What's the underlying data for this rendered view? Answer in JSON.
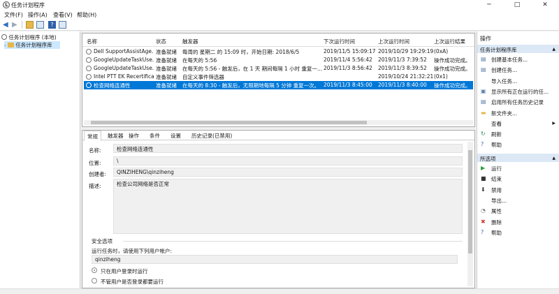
{
  "window": {
    "title": "任务计划程序",
    "min": "─",
    "max": "□",
    "close": "✕"
  },
  "menu": [
    "文件(F)",
    "操作(A)",
    "查看(V)",
    "帮助(H)"
  ],
  "tree": {
    "root": "任务计划程序 (本地)",
    "child": "任务计划程序库"
  },
  "columns": [
    "名称",
    "状态",
    "触发器",
    "下次运行时间",
    "上次运行时间",
    "上次运行结果"
  ],
  "tasks": [
    [
      "Dell SupportAssistAge...",
      "准备就绪",
      "每周的 星期二 的 15:09 时，开始日期: 2018/6/5",
      "2019/11/5 15:09:17",
      "2019/10/29 19:29:19",
      "(0xA)"
    ],
    [
      "GoogleUpdateTaskUse...",
      "准备就绪",
      "在每天的 5:56",
      "2019/11/4 5:56:42",
      "2019/11/3 7:39:52",
      "操作成功完成。"
    ],
    [
      "GoogleUpdateTaskUse...",
      "准备就绪",
      "在每天的 5:56 - 触发后，在 1 天 期间每隔 1 小时 重复一...",
      "2019/11/3 8:56:42",
      "2019/11/3 8:39:52",
      "操作成功完成。"
    ],
    [
      "Intel PTT EK Recertifica...",
      "准备就绪",
      "自定义事件筛选器",
      "",
      "2019/10/24 21:32:21",
      "(0x1)"
    ],
    [
      "检查网络连通性",
      "准备就绪",
      "在每天的 8:30 - 触发后，无限期地每隔 5 分钟 重复一次。",
      "2019/11/3 8:45:00",
      "2019/11/3 8:40:00",
      "操作成功完成。"
    ]
  ],
  "detail_tabs": [
    "常规",
    "触发器",
    "操作",
    "条件",
    "设置",
    "历史记录(已禁用)"
  ],
  "detail": {
    "name_label": "名称:",
    "name": "检查网络连通性",
    "location_label": "位置:",
    "location": "\\",
    "author_label": "创建者:",
    "author": "QINZIHENG\\qinziheng",
    "desc_label": "描述:",
    "desc": "检查公司网络是否正常",
    "security_title": "安全选项",
    "run_as_label": "运行任务时，请使用下列用户帐户:",
    "run_as_user": "qinziheng",
    "radio1": "只在用户登录时运行",
    "radio2": "不管用户是否登录都要运行"
  },
  "actions": {
    "title": "操作",
    "section1": "任务计划程序库",
    "items1": [
      {
        "icon": "create-basic-task-icon",
        "glyph": "▤",
        "color": "#5a7ea8",
        "label": "创建基本任务..."
      },
      {
        "icon": "create-task-icon",
        "glyph": "▤",
        "color": "#5a7ea8",
        "label": "创建任务..."
      },
      {
        "icon": "blank-icon",
        "glyph": "",
        "color": "#000",
        "label": "导入任务..."
      },
      {
        "icon": "running-tasks-icon",
        "glyph": "▣",
        "color": "#5a7ea8",
        "label": "显示所有正在运行的任..."
      },
      {
        "icon": "history-icon",
        "glyph": "▤",
        "color": "#5a7ea8",
        "label": "启用所有任务历史记录"
      },
      {
        "icon": "folder-icon",
        "glyph": "▬",
        "color": "#e6b84a",
        "label": "新文件夹..."
      },
      {
        "icon": "blank-icon",
        "glyph": "",
        "color": "#000",
        "label": "查看",
        "sub": "▶"
      },
      {
        "icon": "refresh-icon",
        "glyph": "↻",
        "color": "#2e8b57",
        "label": "刷新"
      },
      {
        "icon": "help-icon",
        "glyph": "?",
        "color": "#2f5fa8",
        "label": "帮助"
      }
    ],
    "section2": "所选项",
    "items2": [
      {
        "icon": "run-icon",
        "glyph": "▶",
        "color": "#2e9d3e",
        "label": "运行"
      },
      {
        "icon": "end-icon",
        "glyph": "■",
        "color": "#333",
        "label": "结束"
      },
      {
        "icon": "disable-icon",
        "glyph": "⬇",
        "color": "#333",
        "label": "禁用"
      },
      {
        "icon": "blank-icon",
        "glyph": "",
        "color": "#000",
        "label": "导出..."
      },
      {
        "icon": "properties-icon",
        "glyph": "◔",
        "color": "#777",
        "label": "属性"
      },
      {
        "icon": "delete-icon",
        "glyph": "✖",
        "color": "#d23b2f",
        "label": "删除"
      },
      {
        "icon": "help-icon",
        "glyph": "?",
        "color": "#2f5fa8",
        "label": "帮助"
      }
    ]
  }
}
